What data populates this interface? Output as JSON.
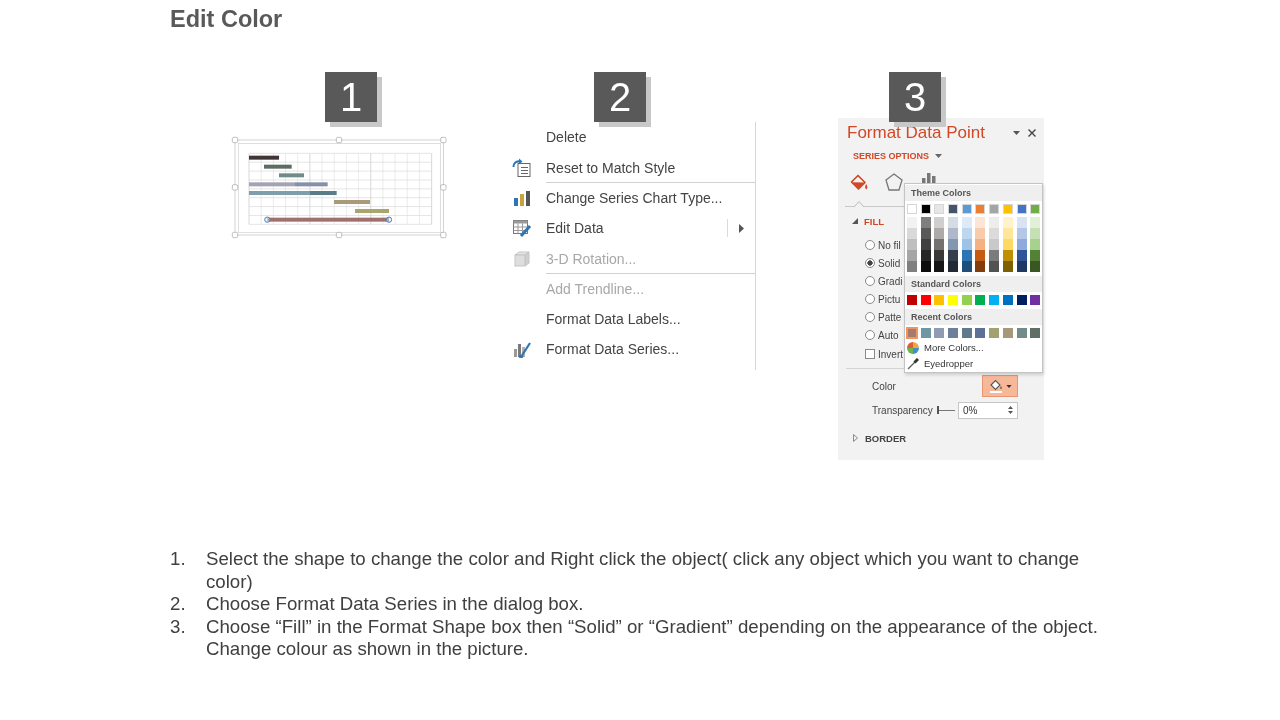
{
  "title": "Edit Color",
  "steps": [
    {
      "number": "1",
      "kind": "chart"
    },
    {
      "number": "2",
      "kind": "menu",
      "menu_items": [
        {
          "label": "Delete",
          "disabled": false,
          "submenu": false,
          "separator_after": false
        },
        {
          "label": "Reset to Match Style",
          "disabled": false,
          "submenu": false,
          "separator_after": true
        },
        {
          "label": "Change Series Chart Type...",
          "disabled": false,
          "submenu": false,
          "separator_after": false
        },
        {
          "label": "Edit Data",
          "disabled": false,
          "submenu": true,
          "separator_after": false
        },
        {
          "label": "3-D Rotation...",
          "disabled": true,
          "submenu": false,
          "separator_after": true
        },
        {
          "label": "Add Trendline...",
          "disabled": true,
          "submenu": false,
          "separator_after": false
        },
        {
          "label": "Format Data Labels...",
          "disabled": false,
          "submenu": false,
          "separator_after": false
        },
        {
          "label": "Format Data Series...",
          "disabled": false,
          "submenu": false,
          "separator_after": false
        }
      ]
    },
    {
      "number": "3",
      "kind": "pane",
      "pane": {
        "title": "Format Data Point",
        "options_label": "SERIES OPTIONS",
        "tabs": [
          {
            "selected": true
          },
          {
            "selected": false
          },
          {
            "selected": false
          }
        ],
        "fill": {
          "label": "FILL",
          "expanded": true,
          "options": [
            {
              "label": "No fil",
              "selected": false
            },
            {
              "label": "Solid",
              "selected": true
            },
            {
              "label": "Gradi",
              "selected": false
            },
            {
              "label": "Pictu",
              "selected": false
            },
            {
              "label": "Patte",
              "selected": false
            },
            {
              "label": "Auto",
              "selected": false
            }
          ],
          "invert": {
            "label": "Invert",
            "checked": false
          },
          "color": {
            "label": "Color",
            "pressed": true
          },
          "transparency": {
            "label": "Transparency",
            "level": 0,
            "value": "0%"
          }
        },
        "border": {
          "label": "BORDER",
          "expanded": false
        },
        "color_picker": {
          "theme_label": "Theme Colors",
          "theme_colors": [
            {
              "color": "#ffffff",
              "shades": [
                {
                  "color": "#f2f2f2"
                },
                {
                  "color": "#d9d9d9"
                },
                {
                  "color": "#bfbfbf"
                },
                {
                  "color": "#a6a6a6"
                },
                {
                  "color": "#808080"
                }
              ]
            },
            {
              "color": "#000000",
              "shades": [
                {
                  "color": "#7f7f7f"
                },
                {
                  "color": "#595959"
                },
                {
                  "color": "#404040"
                },
                {
                  "color": "#262626"
                },
                {
                  "color": "#0d0d0d"
                }
              ]
            },
            {
              "color": "#e7e6e6",
              "shades": [
                {
                  "color": "#d0cece"
                },
                {
                  "color": "#aeaaaa"
                },
                {
                  "color": "#767171"
                },
                {
                  "color": "#3b3838"
                },
                {
                  "color": "#171616"
                }
              ]
            },
            {
              "color": "#44546a",
              "shades": [
                {
                  "color": "#d6dce4"
                },
                {
                  "color": "#adb9ca"
                },
                {
                  "color": "#8497b0"
                },
                {
                  "color": "#333f4f"
                },
                {
                  "color": "#222a35"
                }
              ]
            },
            {
              "color": "#5b9bd5",
              "shades": [
                {
                  "color": "#deebf6"
                },
                {
                  "color": "#bdd7ee"
                },
                {
                  "color": "#9dc3e6"
                },
                {
                  "color": "#2e75b5"
                },
                {
                  "color": "#1f4e79"
                }
              ]
            },
            {
              "color": "#ed7d31",
              "shades": [
                {
                  "color": "#fbe5d5"
                },
                {
                  "color": "#f7cbac"
                },
                {
                  "color": "#f4b183"
                },
                {
                  "color": "#c55a11"
                },
                {
                  "color": "#843c0b"
                }
              ]
            },
            {
              "color": "#a5a5a5",
              "shades": [
                {
                  "color": "#ededed"
                },
                {
                  "color": "#dbdbdb"
                },
                {
                  "color": "#c9c9c9"
                },
                {
                  "color": "#7b7b7b"
                },
                {
                  "color": "#525252"
                }
              ]
            },
            {
              "color": "#ffc000",
              "shades": [
                {
                  "color": "#fff2cc"
                },
                {
                  "color": "#ffe699"
                },
                {
                  "color": "#ffd966"
                },
                {
                  "color": "#bf9000"
                },
                {
                  "color": "#7f6000"
                }
              ]
            },
            {
              "color": "#4472c4",
              "shades": [
                {
                  "color": "#dae3f3"
                },
                {
                  "color": "#b4c7e7"
                },
                {
                  "color": "#8faadc"
                },
                {
                  "color": "#2f5597"
                },
                {
                  "color": "#203864"
                }
              ]
            },
            {
              "color": "#70ad47",
              "shades": [
                {
                  "color": "#e2f0d9"
                },
                {
                  "color": "#c5e0b4"
                },
                {
                  "color": "#a9d18e"
                },
                {
                  "color": "#538135"
                },
                {
                  "color": "#385723"
                }
              ]
            }
          ],
          "standard_label": "Standard Colors",
          "standard_colors": [
            {
              "color": "#c00000"
            },
            {
              "color": "#ff0000"
            },
            {
              "color": "#ffc000"
            },
            {
              "color": "#ffff00"
            },
            {
              "color": "#92d050"
            },
            {
              "color": "#00b050"
            },
            {
              "color": "#00b0f0"
            },
            {
              "color": "#0070c0"
            },
            {
              "color": "#002060"
            },
            {
              "color": "#7030a0"
            }
          ],
          "recent_label": "Recent Colors",
          "recent_colors": [
            {
              "color": "#a57a70",
              "selected": true
            },
            {
              "color": "#6f97a3",
              "selected": false
            },
            {
              "color": "#8e9bb0",
              "selected": false
            },
            {
              "color": "#6e7f99",
              "selected": false
            },
            {
              "color": "#5f7a8d",
              "selected": false
            },
            {
              "color": "#5d7196",
              "selected": false
            },
            {
              "color": "#a3a16f",
              "selected": false
            },
            {
              "color": "#a8987a",
              "selected": false
            },
            {
              "color": "#708b8a",
              "selected": false
            },
            {
              "color": "#5f6e66",
              "selected": false
            }
          ],
          "more_colors_label": "More Colors...",
          "eyedropper_label": "Eyedropper"
        }
      }
    }
  ],
  "instructions": [
    {
      "number": "1.",
      "text": "Select the shape to change the color and Right click the object( click any object which you want to change color)"
    },
    {
      "number": "2.",
      "text": "Choose Format Data Series in the dialog box."
    },
    {
      "number": "3.",
      "text": "Choose “Fill” in the Format Shape box then “Solid” or “Gradient” depending on the appearance of the object. Change colour as shown in the picture."
    }
  ]
}
